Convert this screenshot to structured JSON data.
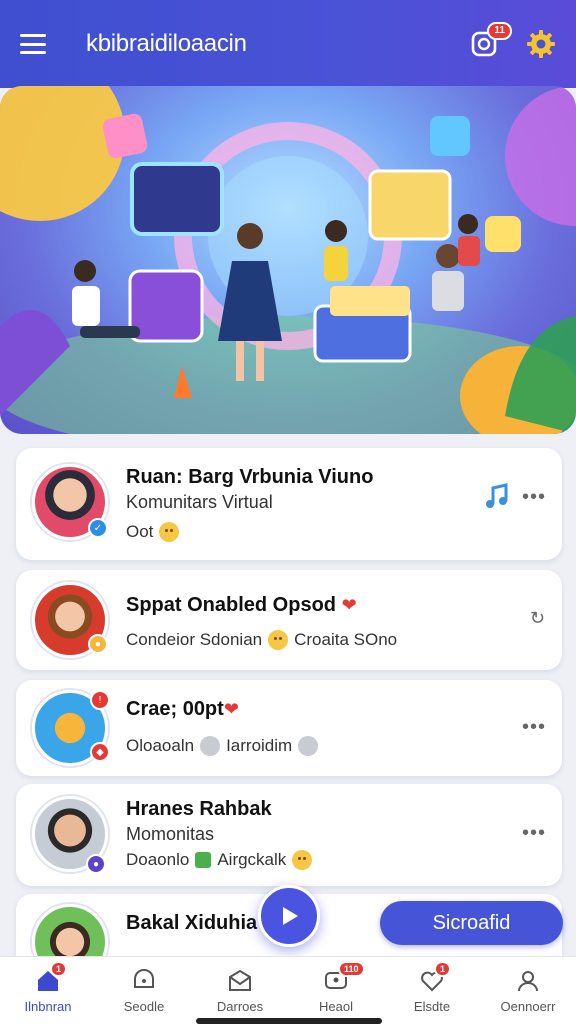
{
  "header": {
    "title": "kbibraidiloaacin",
    "notification_badge": "11"
  },
  "list": [
    {
      "title": "Ruan: Barg Vrbunia Viuno",
      "subtitle": "Komunitars Virtual",
      "line": "Oot"
    },
    {
      "title": "Sppat Onabled Opsod",
      "subtitle": "",
      "line_a": "Condeior Sdonian",
      "line_b": "Croaita SOno"
    },
    {
      "title": "Crae; 00pt",
      "subtitle": "",
      "line_a": "Oloaoaln",
      "line_b": "Iarroidim"
    },
    {
      "title": "Hranes Rahbak",
      "subtitle": "Momonitas",
      "line_a": "Doaonlo",
      "line_b": "Airgckalk"
    },
    {
      "title": "Bakal Xiduhia",
      "subtitle": ""
    }
  ],
  "cta": {
    "label": "Sicroafid"
  },
  "nav": [
    {
      "label": "Ilnbnran",
      "badge": "1"
    },
    {
      "label": "Seodle",
      "badge": ""
    },
    {
      "label": "Darroes",
      "badge": ""
    },
    {
      "label": "Heaol",
      "badge": "110"
    },
    {
      "label": "Elsdte",
      "badge": "1"
    },
    {
      "label": "Oennoerr",
      "badge": ""
    }
  ],
  "colors": {
    "primary": "#4a52d6",
    "accent": "#e53935",
    "surface": "#ffffff"
  }
}
